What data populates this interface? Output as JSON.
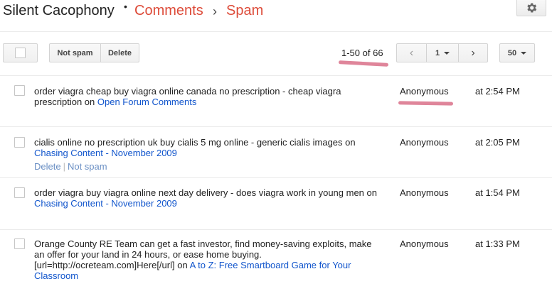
{
  "header": {
    "blog_title": "Silent Cacophony",
    "dot": "•",
    "crumb_comments": "Comments",
    "crumb_separator": "›",
    "crumb_spam": "Spam",
    "settings_icon": "gear-icon"
  },
  "toolbar": {
    "not_spam_label": "Not spam",
    "delete_label": "Delete",
    "range_label": "1-50 of 66",
    "prev_glyph": "‹",
    "page_value": "1",
    "next_glyph": "›",
    "per_page_value": "50"
  },
  "comments": [
    {
      "text": "order viagra cheap buy viagra online canada no prescription - cheap viagra prescription on ",
      "post_link": "Open Forum Comments",
      "author": "Anonymous",
      "time": "at 2:54 PM"
    },
    {
      "text": "cialis online no prescription uk buy cialis 5 mg online - generic cialis images on ",
      "post_link": "Chasing Content - November 2009",
      "author": "Anonymous",
      "time": "at 2:05 PM",
      "action_delete": "Delete",
      "action_sep": "|",
      "action_not_spam": "Not spam"
    },
    {
      "text": "order viagra buy viagra online next day delivery - does viagra work in young men on ",
      "post_link": "Chasing Content - November 2009",
      "author": "Anonymous",
      "time": "at 1:54 PM"
    },
    {
      "text": "Orange County RE Team can get a fast investor, find money-saving exploits, make an offer for your land in 24 hours, or ease home buying. [url=http://ocreteam.com]Here[/url] on ",
      "post_link": "A to Z: Free Smartboard Game for Your Classroom",
      "author": "Anonymous",
      "time": "at 1:33 PM"
    }
  ],
  "colors": {
    "accent_orange": "#dd4b39",
    "link_blue": "#1155cc",
    "annotation_pink": "#d97088"
  }
}
